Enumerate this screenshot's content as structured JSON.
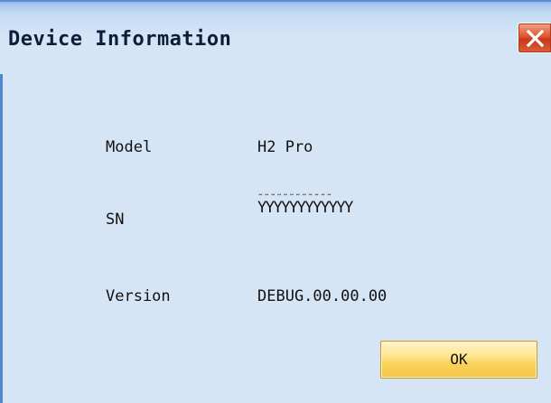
{
  "window": {
    "title": "Device Information",
    "close_icon": "close-icon"
  },
  "info": {
    "model_label": "Model",
    "model_value": "H2 Pro",
    "sn_label": "SN",
    "sn_value": "YYYYYYYYYYYY",
    "version_label": "Version",
    "version_value": "DEBUG.00.00.00"
  },
  "buttons": {
    "ok_label": "OK"
  },
  "colors": {
    "titlebar": "#c6dcf4",
    "body": "#d6e5f6",
    "close_button": "#e0552f",
    "ok_button": "#fbd35a",
    "window_border": "#4f88cf"
  }
}
